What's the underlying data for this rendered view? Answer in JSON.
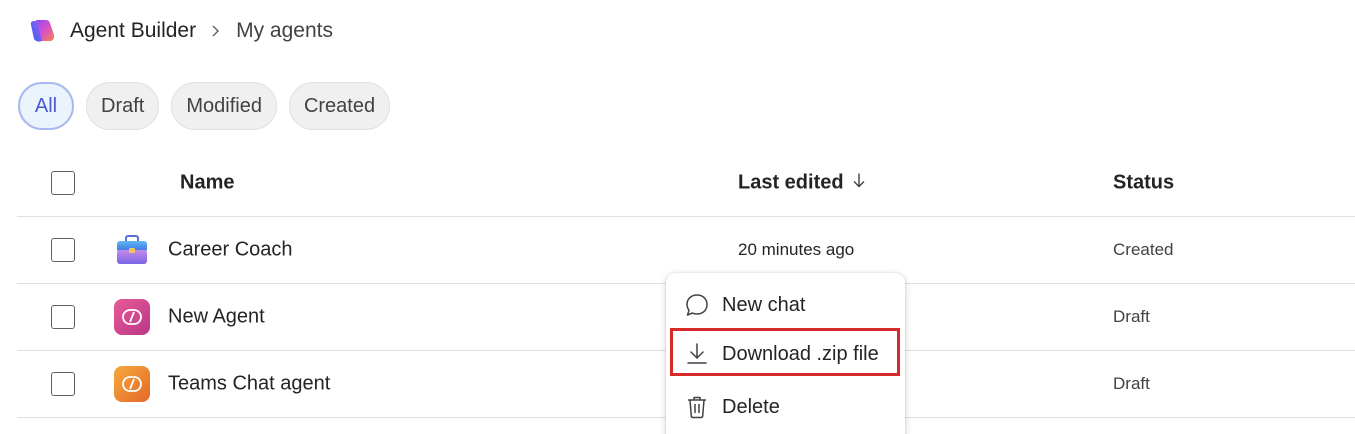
{
  "breadcrumb": {
    "app": "Agent Builder",
    "current": "My agents"
  },
  "filters": [
    {
      "label": "All",
      "active": true
    },
    {
      "label": "Draft",
      "active": false
    },
    {
      "label": "Modified",
      "active": false
    },
    {
      "label": "Created",
      "active": false
    }
  ],
  "table": {
    "columns": {
      "name": "Name",
      "last_edited": "Last edited",
      "status": "Status"
    },
    "rows": [
      {
        "name": "Career Coach",
        "last_edited": "20 minutes ago",
        "status": "Created",
        "icon": "briefcase-icon"
      },
      {
        "name": "New Agent",
        "last_edited": "",
        "status": "Draft",
        "icon": "agent-code-icon"
      },
      {
        "name": "Teams Chat agent",
        "last_edited": "",
        "status": "Draft",
        "icon": "agent-code-icon"
      }
    ]
  },
  "context_menu": {
    "items": [
      {
        "label": "New chat",
        "icon": "chat-bubble-icon"
      },
      {
        "label": "Download .zip file",
        "icon": "download-icon",
        "highlighted": true
      },
      {
        "label": "Delete",
        "icon": "trash-icon"
      }
    ]
  },
  "colors": {
    "active_pill_bg": "#ebf3fc",
    "active_pill_border": "#a9b8ef",
    "active_pill_text": "#4a59d0",
    "highlight_border": "#d42a2a"
  }
}
